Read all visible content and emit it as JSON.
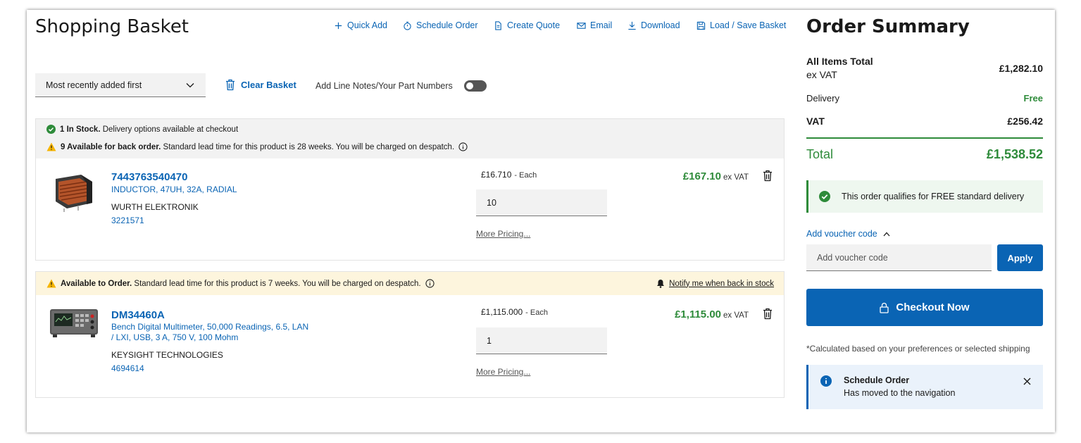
{
  "header": {
    "title": "Shopping Basket",
    "toolbar": [
      {
        "label": "Quick Add",
        "icon": "plus-icon"
      },
      {
        "label": "Schedule Order",
        "icon": "stopwatch-icon"
      },
      {
        "label": "Create Quote",
        "icon": "document-icon"
      },
      {
        "label": "Email",
        "icon": "envelope-icon"
      },
      {
        "label": "Download",
        "icon": "download-icon"
      },
      {
        "label": "Load / Save Basket",
        "icon": "save-icon"
      }
    ]
  },
  "controls": {
    "sort_value": "Most recently added first",
    "clear_label": "Clear Basket",
    "notes_label": "Add Line Notes/Your Part Numbers"
  },
  "items": [
    {
      "banner_line1_bold": "1 In Stock.",
      "banner_line1": "Delivery options available at checkout",
      "banner_line2_bold": "9 Available for back order.",
      "banner_line2": "Standard lead time for this product is 28 weeks. You will be charged on despatch.",
      "part_number": "7443763540470",
      "description": "INDUCTOR, 47UH, 32A, RADIAL",
      "manufacturer": "WURTH ELEKTRONIK",
      "order_code": "3221571",
      "unit_price": "£16.710",
      "unit_suffix": "- Each",
      "quantity": "10",
      "more_pricing": "More Pricing...",
      "line_total": "£167.10",
      "vat_suffix": "ex VAT"
    },
    {
      "banner_line1_bold": "Available to Order.",
      "banner_line1": "Standard lead time for this product is 7 weeks. You will be charged on despatch.",
      "notify_label": "Notify me when back in stock",
      "part_number": "DM34460A",
      "description_line1": "Bench Digital Multimeter, 50,000 Readings, 6.5, LAN",
      "description_line2": "/ LXI, USB, 3 A, 750 V, 100 Mohm",
      "manufacturer": "KEYSIGHT TECHNOLOGIES",
      "order_code": "4694614",
      "unit_price": "£1,115.000",
      "unit_suffix": "- Each",
      "quantity": "1",
      "more_pricing": "More Pricing...",
      "line_total": "£1,115.00",
      "vat_suffix": "ex VAT"
    }
  ],
  "summary": {
    "title": "Order Summary",
    "items_total_label_1": "All Items Total",
    "items_total_label_2": "ex VAT",
    "items_total_value": "£1,282.10",
    "delivery_label": "Delivery",
    "delivery_value": "Free",
    "vat_label": "VAT",
    "vat_value": "£256.42",
    "total_label": "Total",
    "total_value": "£1,538.52",
    "free_delivery_msg": "This order qualifies for FREE standard delivery",
    "voucher_link": "Add voucher code",
    "voucher_placeholder": "Add voucher code",
    "apply_label": "Apply",
    "checkout_label": "Checkout Now",
    "calc_note": "*Calculated based on your preferences or selected shipping",
    "schedule_title": "Schedule Order",
    "schedule_msg": "Has moved to the navigation"
  },
  "colors": {
    "brand_blue": "#0a64b4",
    "price_green": "#2e8b3a",
    "warning_yellow": "#f5b400",
    "stock_banner_bg": "#f2f2f2",
    "order_banner_bg": "#fdf5dd"
  }
}
